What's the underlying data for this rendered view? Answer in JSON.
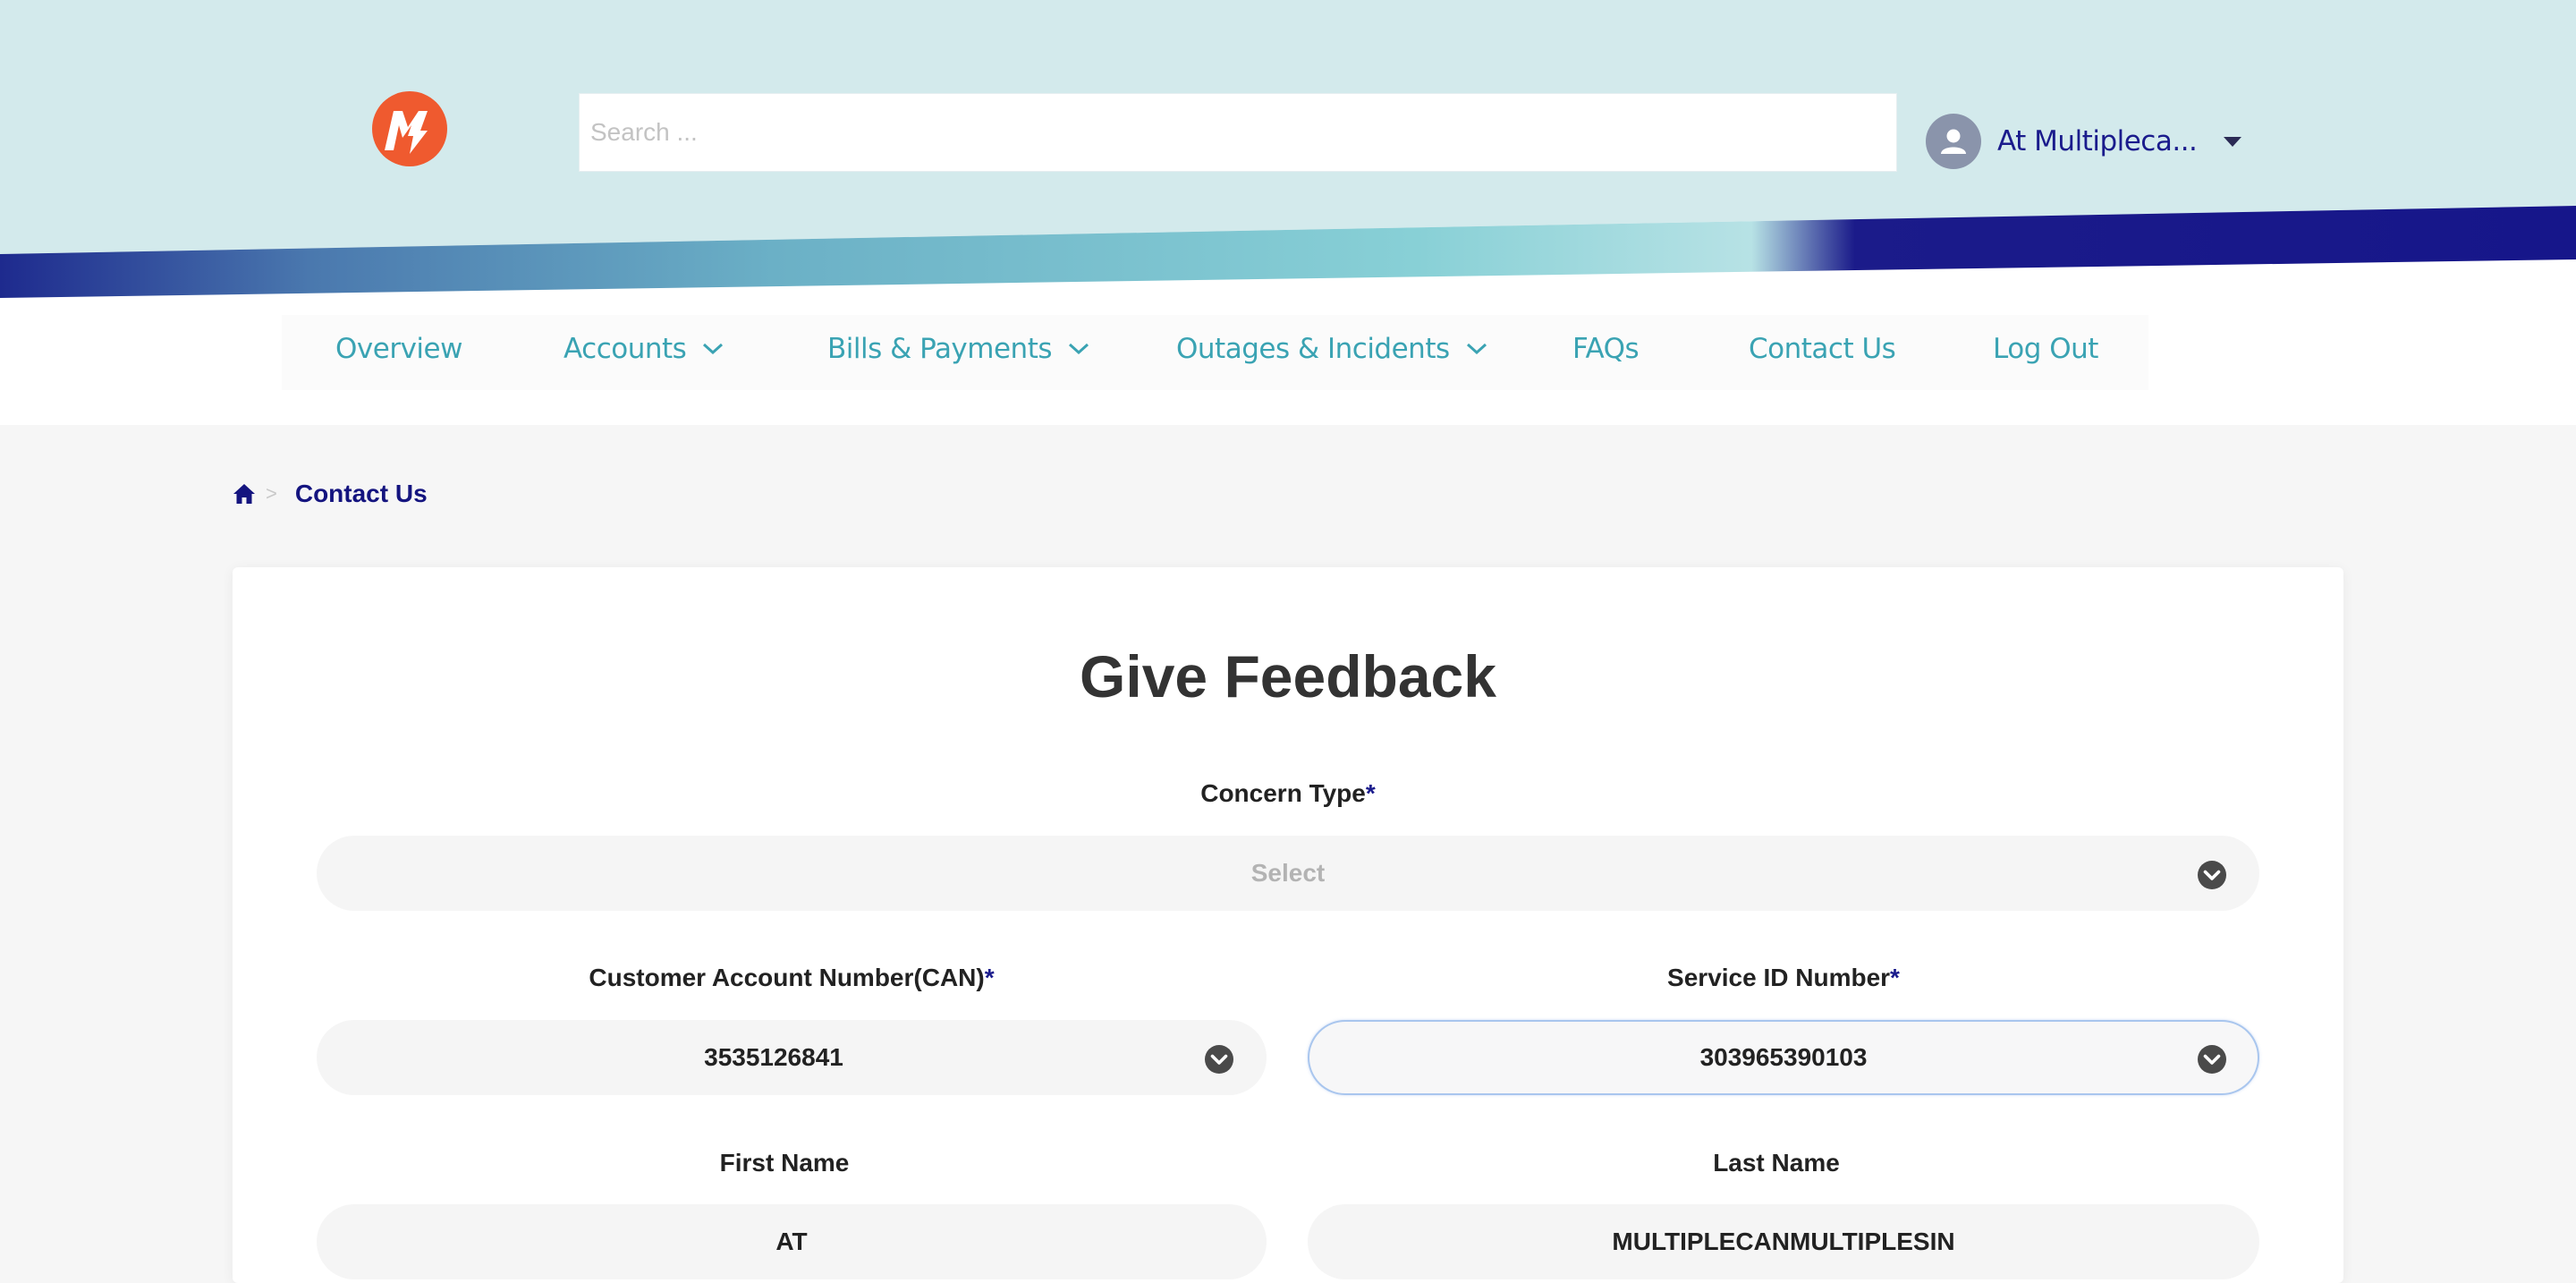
{
  "header": {
    "search_placeholder": "Search ...",
    "user_name": "At Multipleca...",
    "colors": {
      "header_bg": "#d3eaec",
      "brand_orange": "#ef5a2f",
      "brand_navy": "#1a1b8c",
      "nav_teal": "#3aa3b3"
    }
  },
  "nav": {
    "items": [
      {
        "label": "Overview",
        "has_dropdown": false
      },
      {
        "label": "Accounts",
        "has_dropdown": true
      },
      {
        "label": "Bills & Payments",
        "has_dropdown": true
      },
      {
        "label": "Outages & Incidents",
        "has_dropdown": true
      },
      {
        "label": "FAQs",
        "has_dropdown": false
      },
      {
        "label": "Contact Us",
        "has_dropdown": false
      },
      {
        "label": "Log Out",
        "has_dropdown": false
      }
    ]
  },
  "breadcrumb": {
    "home_icon": "home-icon",
    "separator": ">",
    "current": "Contact Us"
  },
  "form": {
    "title": "Give Feedback",
    "required_marker": "*",
    "concern_type": {
      "label": "Concern Type",
      "value": "Select",
      "required": true
    },
    "can": {
      "label": "Customer Account Number(CAN)",
      "value": "3535126841",
      "required": true
    },
    "service_id": {
      "label": "Service ID Number",
      "value": "303965390103",
      "required": true
    },
    "first_name": {
      "label": "First Name",
      "value": "AT"
    },
    "last_name": {
      "label": "Last Name",
      "value": "MULTIPLECANMULTIPLESIN"
    }
  }
}
